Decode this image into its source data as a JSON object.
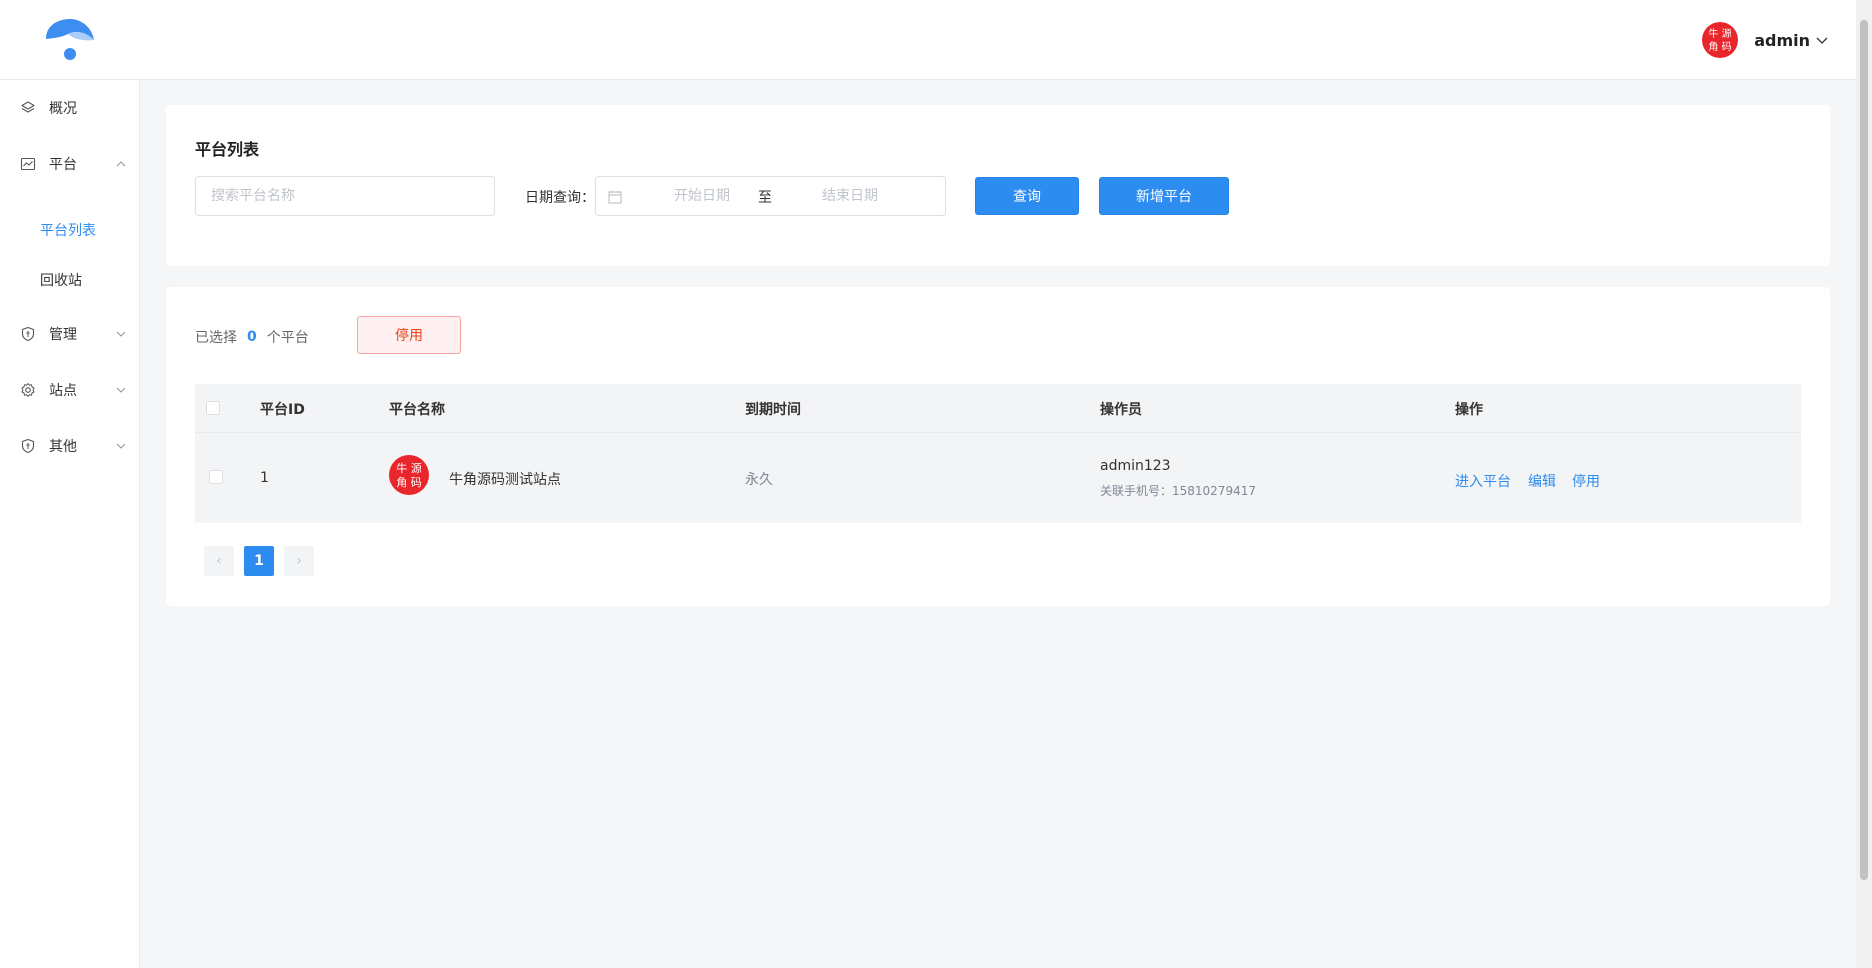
{
  "header": {
    "username": "admin",
    "avatar_text_top": "牛 源",
    "avatar_text_bottom": "角 码"
  },
  "sidebar": {
    "items": [
      {
        "label": "概况"
      },
      {
        "label": "平台"
      },
      {
        "label": "管理"
      },
      {
        "label": "站点"
      },
      {
        "label": "其他"
      }
    ],
    "sub_items": [
      {
        "label": "平台列表"
      },
      {
        "label": "回收站"
      }
    ]
  },
  "filter": {
    "title": "平台列表",
    "search_placeholder": "搜索平台名称",
    "date_label": "日期查询：",
    "start_placeholder": "开始日期",
    "range_sep": "至",
    "end_placeholder": "结束日期",
    "query_button": "查询",
    "add_button": "新增平台"
  },
  "list": {
    "selected_prefix": "已选择",
    "selected_count": "0",
    "selected_suffix": "个平台",
    "disable_button": "停用",
    "columns": [
      "平台ID",
      "平台名称",
      "到期时间",
      "操作员",
      "操作"
    ],
    "rows": [
      {
        "id": "1",
        "name": "牛角源码测试站点",
        "expire": "永久",
        "operator": "admin123",
        "phone": "关联手机号：15810279417",
        "actions": [
          "进入平台",
          "编辑",
          "停用"
        ]
      }
    ]
  },
  "pagination": {
    "prev": "‹",
    "current": "1",
    "next": "›"
  },
  "colors": {
    "primary": "#2d8cf0",
    "danger": "#ed4014",
    "avatar_red": "#e8262c"
  }
}
